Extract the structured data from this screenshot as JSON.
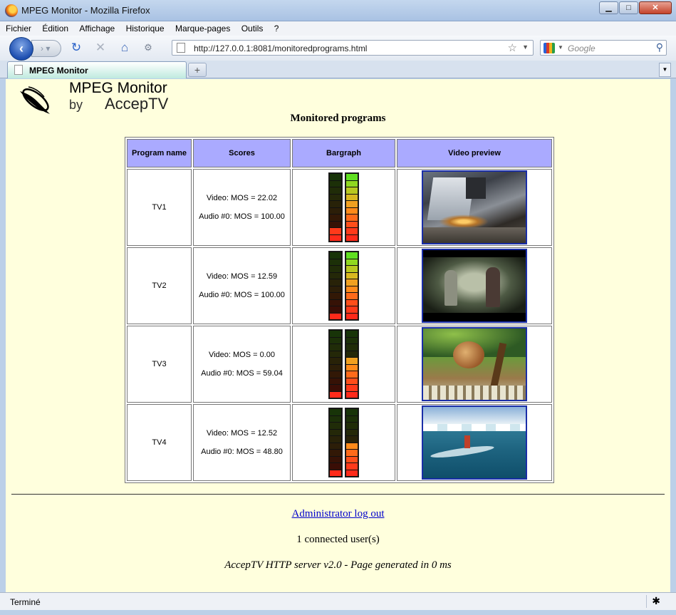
{
  "window": {
    "title": "MPEG Monitor - Mozilla Firefox"
  },
  "menu": [
    "Fichier",
    "Édition",
    "Affichage",
    "Historique",
    "Marque-pages",
    "Outils",
    "?"
  ],
  "nav": {
    "url": "http://127.0.0.1:8081/monitoredprograms.html",
    "search_placeholder": "Google"
  },
  "tab": {
    "title": "MPEG Monitor",
    "new_tab": "+"
  },
  "logo": {
    "title": "MPEG Monitor",
    "by": "by",
    "brand": "AccepTV"
  },
  "page": {
    "title": "Monitored programs"
  },
  "table": {
    "headers": [
      "Program name",
      "Scores",
      "Bargraph",
      "Video preview"
    ],
    "rows": [
      {
        "name": "TV1",
        "video": "Video: MOS = 22.02",
        "audio": "Audio #0: MOS = 100.00",
        "video_level": 0.2,
        "audio_level": 1.0
      },
      {
        "name": "TV2",
        "video": "Video: MOS = 12.59",
        "audio": "Audio #0: MOS = 100.00",
        "video_level": 0.1,
        "audio_level": 1.0
      },
      {
        "name": "TV3",
        "video": "Video: MOS = 0.00",
        "audio": "Audio #0: MOS = 59.04",
        "video_level": 0.0,
        "audio_level": 0.6
      },
      {
        "name": "TV4",
        "video": "Video: MOS = 12.52",
        "audio": "Audio #0: MOS = 48.80",
        "video_level": 0.1,
        "audio_level": 0.5
      }
    ]
  },
  "footer": {
    "logout": "Administrator log out",
    "users": "1 connected user(s)",
    "server": "AccepTV HTTP server v2.0 - Page generated in 0 ms"
  },
  "status": {
    "text": "Terminé"
  },
  "colors": {
    "content_bg": "#ffffdd",
    "header_bg": "#aaaaff",
    "link": "#0000cc",
    "preview_border": "#1a2ea8"
  }
}
